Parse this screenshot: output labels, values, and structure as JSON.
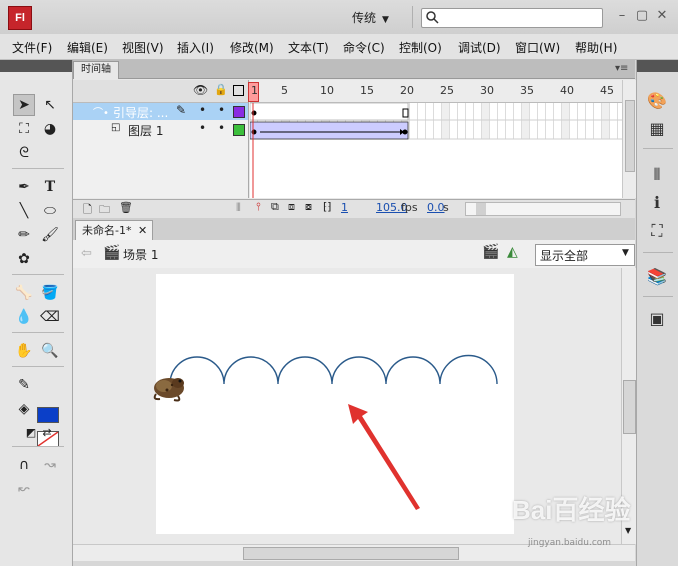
{
  "app": {
    "logo_text": "Fl",
    "workspace": "传统"
  },
  "menu": [
    "文件(F)",
    "编辑(E)",
    "视图(V)",
    "插入(I)",
    "修改(M)",
    "文本(T)",
    "命令(C)",
    "控制(O)",
    "调试(D)",
    "窗口(W)",
    "帮助(H)"
  ],
  "timeline": {
    "tab": "时间轴",
    "frame_numbers": [
      "1",
      "5",
      "10",
      "15",
      "20",
      "25",
      "30",
      "35",
      "40",
      "45"
    ],
    "layers": [
      {
        "name": "引导层: ...",
        "type": "guide",
        "color": "#8a2be2",
        "selected": true
      },
      {
        "name": "图层 1",
        "type": "normal",
        "color": "#3cbf3c",
        "selected": false
      }
    ],
    "current_frame": "1",
    "fps": "105.0",
    "fps_unit": "fps",
    "time": "0.0",
    "time_unit": "s"
  },
  "document": {
    "tab": "未命名-1*",
    "scene": "场景 1",
    "zoom": "显示全部"
  },
  "watermark": {
    "main": "Bai百经验",
    "sub": "jingyan.baidu.com"
  },
  "colors": {
    "stroke": "#000000",
    "fill": "#0b3fc8",
    "path": "#2a5a8a",
    "arrow": "#e0322e",
    "layer_highlight": "#aad2f5"
  }
}
